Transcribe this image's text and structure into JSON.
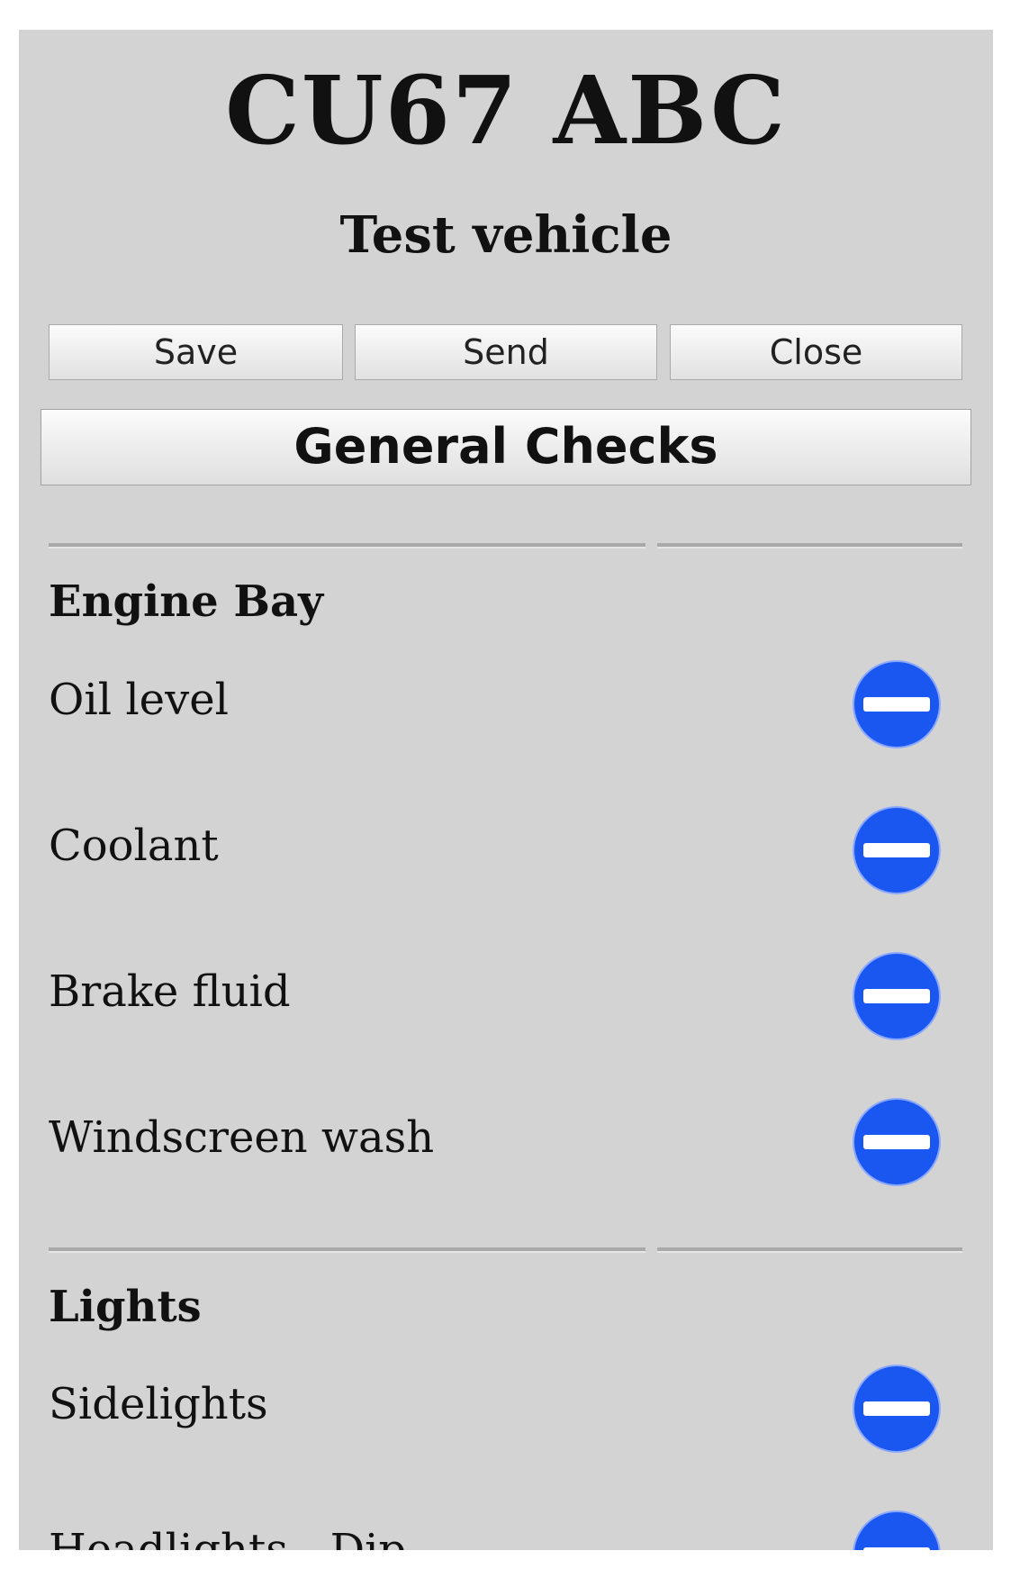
{
  "header": {
    "registration": "CU67 ABC",
    "vehicle_name": "Test vehicle"
  },
  "toolbar": {
    "save_label": "Save",
    "send_label": "Send",
    "close_label": "Close"
  },
  "section": {
    "title": "General Checks"
  },
  "groups": [
    {
      "title": "Engine Bay",
      "items": [
        {
          "label": "Oil level",
          "status_icon": "no-entry-icon",
          "status_color": "#1a56f0"
        },
        {
          "label": "Coolant",
          "status_icon": "no-entry-icon",
          "status_color": "#1a56f0"
        },
        {
          "label": "Brake fluid",
          "status_icon": "no-entry-icon",
          "status_color": "#1a56f0"
        },
        {
          "label": "Windscreen wash",
          "status_icon": "no-entry-icon",
          "status_color": "#1a56f0"
        }
      ]
    },
    {
      "title": "Lights",
      "items": [
        {
          "label": "Sidelights",
          "status_icon": "no-entry-icon",
          "status_color": "#1a56f0"
        },
        {
          "label": "Headlights - Dip",
          "status_icon": "no-entry-icon",
          "status_color": "#1a56f0"
        }
      ]
    }
  ]
}
